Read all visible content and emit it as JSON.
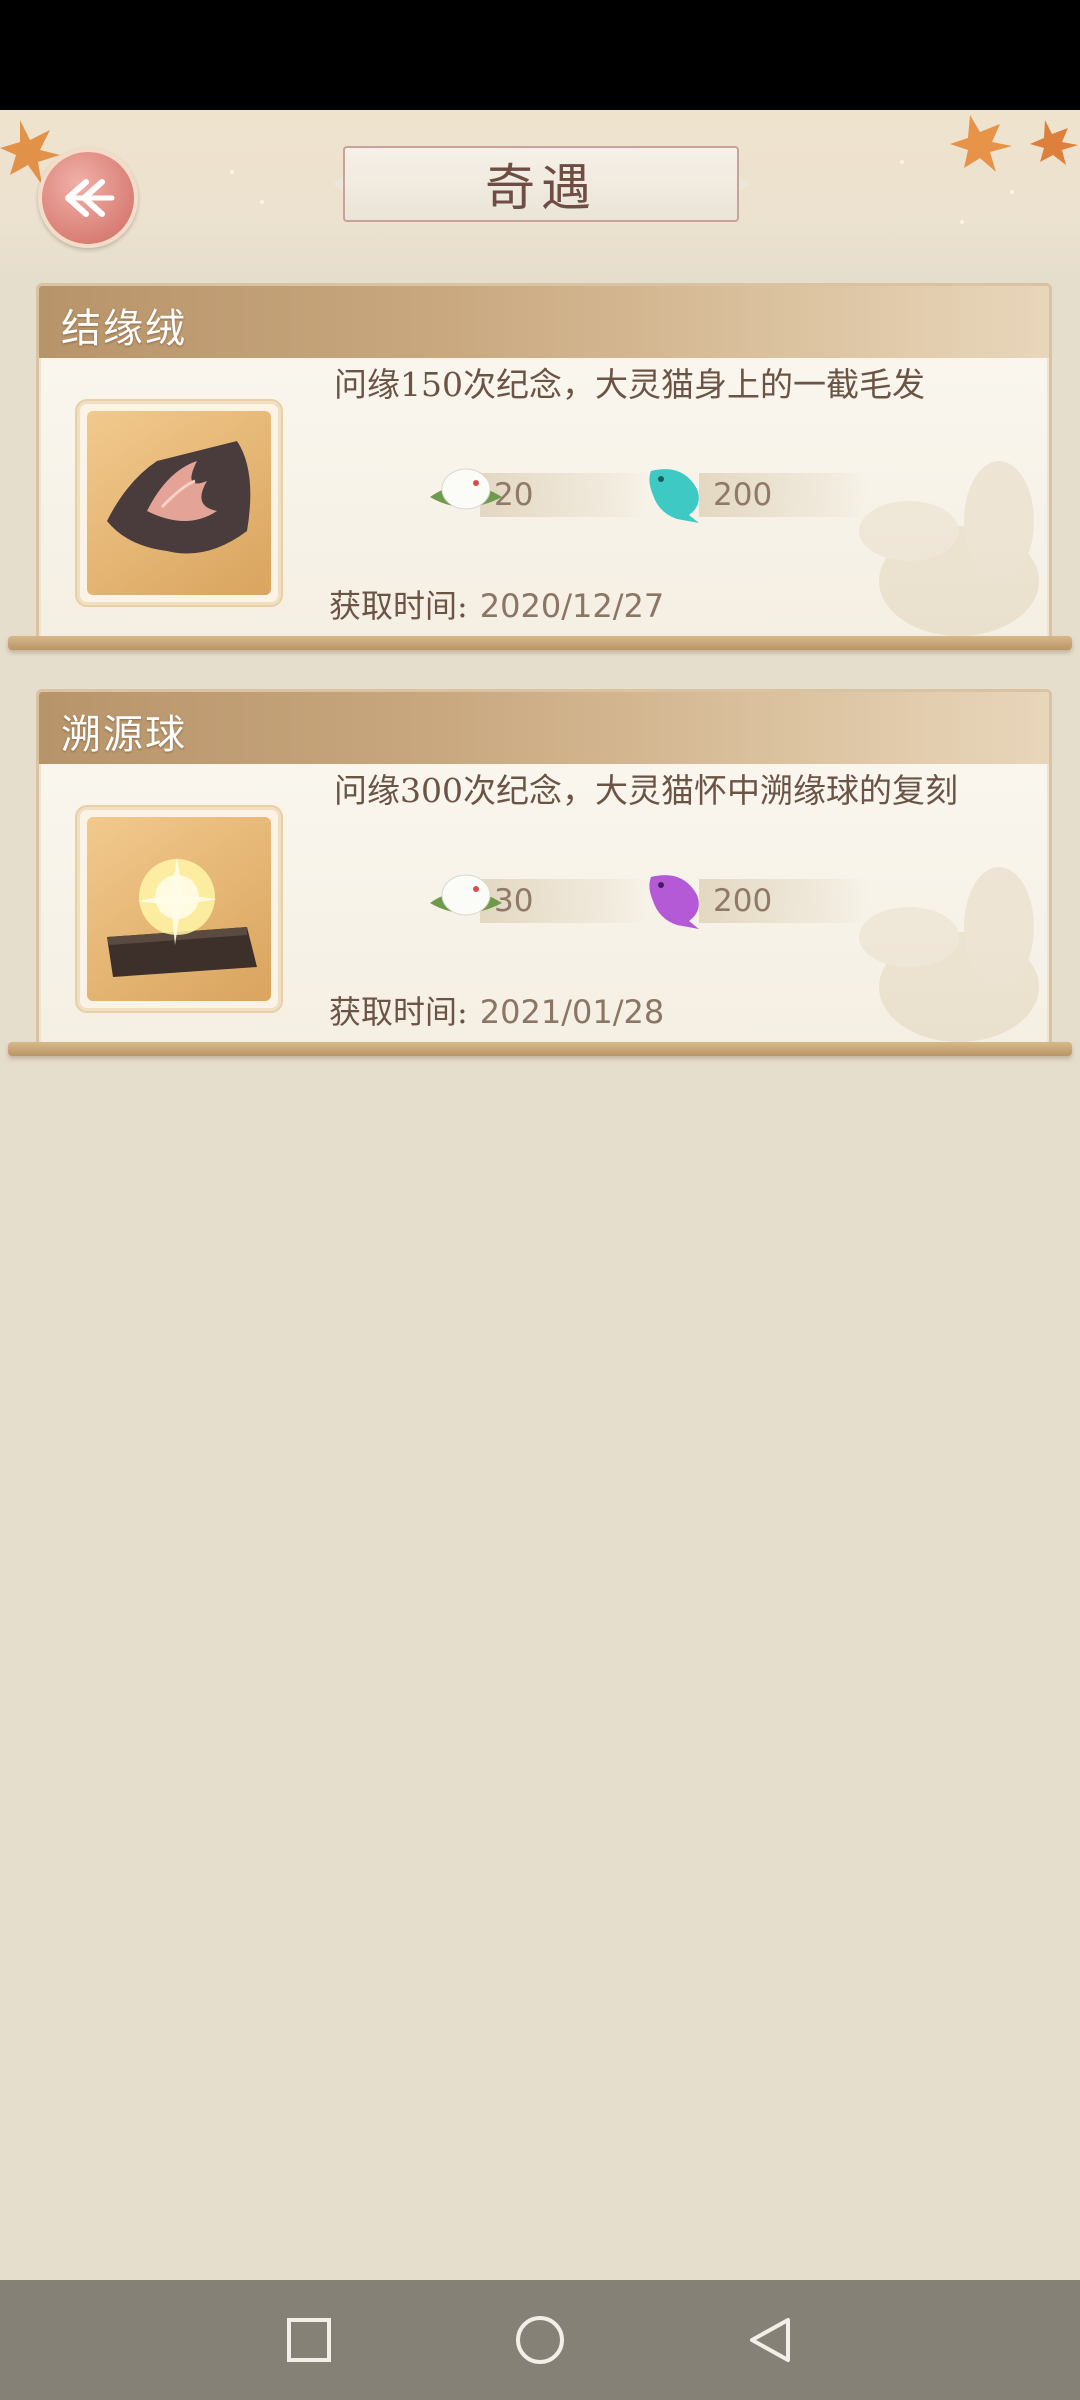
{
  "header": {
    "title": "奇遇"
  },
  "icons": {
    "back": "back-arrow-icon",
    "candy": "rice-ball-icon",
    "fish_cyan": "cyan-fish-icon",
    "fish_purple": "purple-fish-icon"
  },
  "cards": [
    {
      "title": "结缘绒",
      "description": "问缘150次纪念，大灵猫身上的一截毛发",
      "reward1": "20",
      "reward2": "200",
      "date_label": "获取时间:",
      "date": "2020/12/27"
    },
    {
      "title": "溯源球",
      "description": "问缘300次纪念，大灵猫怀中溯缘球的复刻",
      "reward1": "30",
      "reward2": "200",
      "date_label": "获取时间:",
      "date": "2021/01/28"
    }
  ],
  "colors": {
    "accent": "#d97f76",
    "header_band": "#c9a87f",
    "background": "#e6decd",
    "nav": "#868176"
  }
}
